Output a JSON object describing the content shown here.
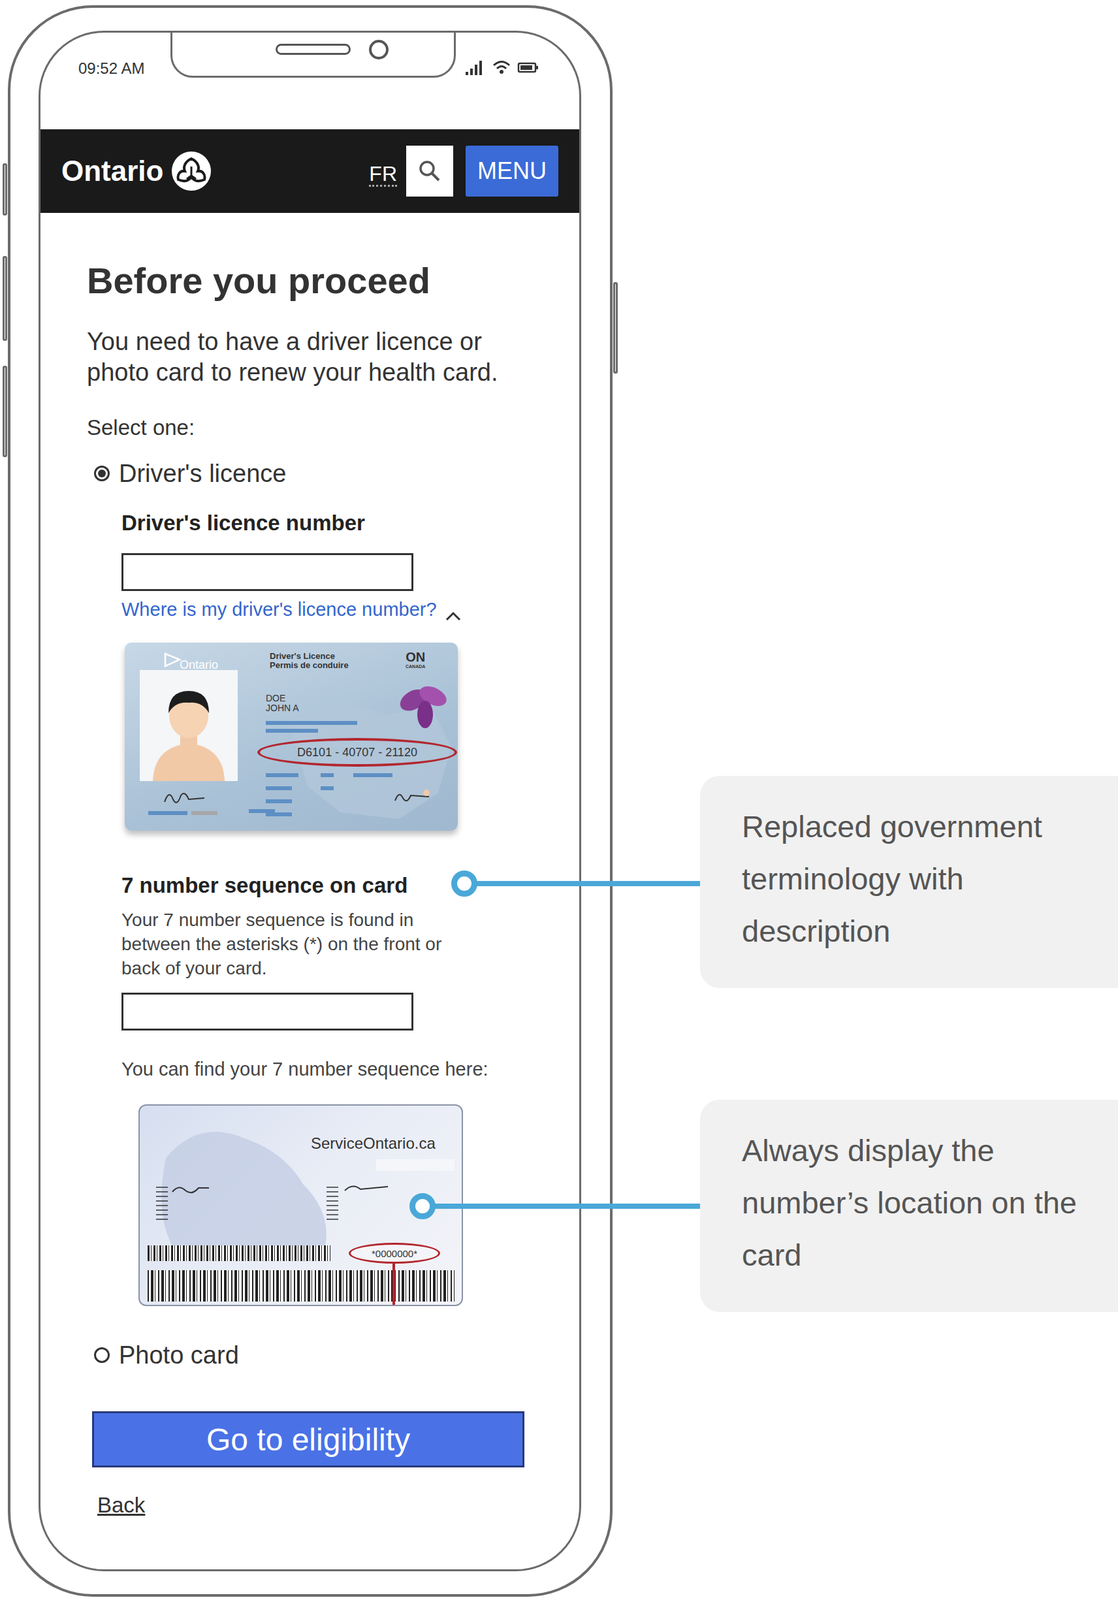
{
  "status_bar": {
    "time": "09:52 AM"
  },
  "header": {
    "logo": "Ontario",
    "language": "FR",
    "menu": "MENU"
  },
  "page": {
    "title": "Before you proceed",
    "intro": "You need to have a driver licence or photo card to renew your health card.",
    "select_label": "Select one:"
  },
  "options": [
    {
      "label": "Driver's licence",
      "selected": true
    },
    {
      "label": "Photo card",
      "selected": false
    }
  ],
  "licence_field": {
    "label": "Driver's licence number",
    "value": "",
    "help_link": "Where is my driver's licence number?",
    "help_expanded": true
  },
  "licence_card": {
    "province": "Ontario",
    "title": "Driver's Licence",
    "subtitle": "Permis de conduire",
    "code": "ON",
    "country": "CANADA",
    "surname": "DOE",
    "given_names": "JOHN A",
    "number": "D6101 - 40707 - 21120"
  },
  "sequence_field": {
    "label": "7 number sequence on card",
    "description": "Your 7 number sequence is found in between the asterisks (*) on the front or back of your card.",
    "value": "",
    "hint": "You can find your 7 number sequence here:"
  },
  "card_back": {
    "website": "ServiceOntario.ca",
    "sequence": "*0000000*"
  },
  "buttons": {
    "primary": "Go to eligibility",
    "back": "Back"
  },
  "annotations": [
    {
      "text": "Replaced government terminology with description"
    },
    {
      "text": "Always display the number’s location on the card"
    }
  ]
}
